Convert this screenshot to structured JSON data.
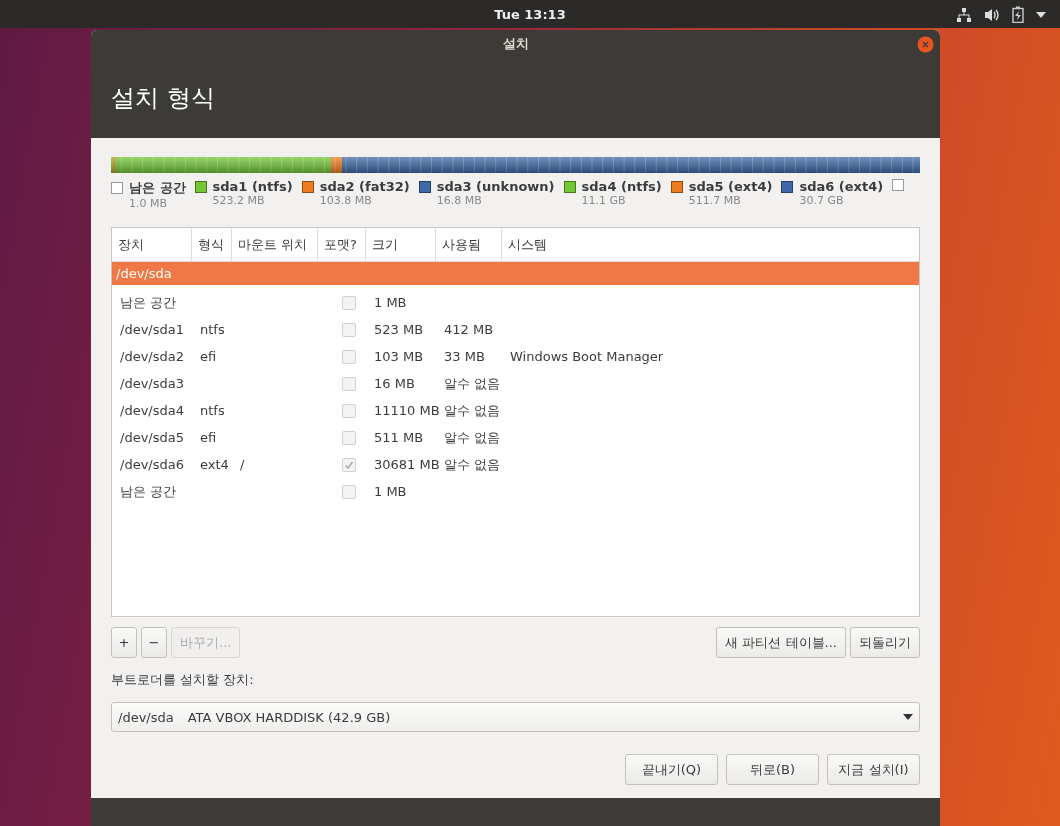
{
  "top_bar": {
    "clock": "Tue 13:13"
  },
  "window": {
    "title": "설치",
    "heading": "설치 형식"
  },
  "legend": [
    {
      "name": "남은 공간",
      "size": "1.0 MB",
      "color": "#ffffff"
    },
    {
      "name": "sda1 (ntfs)",
      "size": "523.2 MB",
      "color": "#73c737"
    },
    {
      "name": "sda2 (fat32)",
      "size": "103.8 MB",
      "color": "#ef7d1f"
    },
    {
      "name": "sda3 (unknown)",
      "size": "16.8 MB",
      "color": "#3e68a6"
    },
    {
      "name": "sda4 (ntfs)",
      "size": "11.1 GB",
      "color": "#73c737"
    },
    {
      "name": "sda5 (ext4)",
      "size": "511.7 MB",
      "color": "#ef7d1f"
    },
    {
      "name": "sda6 (ext4)",
      "size": "30.7 GB",
      "color": "#3e68a6"
    },
    {
      "color": "#ffffff"
    }
  ],
  "table": {
    "columns": [
      "장치",
      "형식",
      "마운트 위치",
      "포맷?",
      "크기",
      "사용됨",
      "시스템"
    ],
    "rows": [
      {
        "kind": "disk",
        "device": "/dev/sda",
        "selected": true
      },
      {
        "kind": "partition",
        "device": "남은 공간",
        "format": false,
        "size": "1 MB",
        "selected": false
      },
      {
        "kind": "partition",
        "device": "/dev/sda1",
        "type": "ntfs",
        "format": false,
        "size": "523 MB",
        "used": "412 MB",
        "selected": false
      },
      {
        "kind": "partition",
        "device": "/dev/sda2",
        "type": "efi",
        "format": false,
        "size": "103 MB",
        "used": "33 MB",
        "system": "Windows Boot Manager",
        "selected": false
      },
      {
        "kind": "partition",
        "device": "/dev/sda3",
        "format": false,
        "size": "16 MB",
        "used": "알수 없음",
        "selected": false
      },
      {
        "kind": "partition",
        "device": "/dev/sda4",
        "type": "ntfs",
        "format": false,
        "size": "11110 MB",
        "used": "알수 없음",
        "selected": false
      },
      {
        "kind": "partition",
        "device": "/dev/sda5",
        "type": "efi",
        "format": false,
        "size": "511 MB",
        "used": "알수 없음",
        "selected": false
      },
      {
        "kind": "partition",
        "device": "/dev/sda6",
        "type": "ext4",
        "mount": "/",
        "format": true,
        "size": "30681 MB",
        "used": "알수 없음",
        "selected": false
      },
      {
        "kind": "partition",
        "device": "남은 공간",
        "format": false,
        "size": "1 MB",
        "selected": false
      }
    ]
  },
  "table_buttons": [
    {
      "label": "+",
      "disabled": false
    },
    {
      "label": "−",
      "disabled": false
    },
    {
      "label": "바꾸기...",
      "disabled": true
    }
  ],
  "table_actions": [
    "새 파티션 테이블...",
    "되돌리기"
  ],
  "bootloader": {
    "label": "부트로더를 설치할 장치:",
    "device": "/dev/sda",
    "description": "ATA VBOX HARDDISK (42.9 GB)"
  },
  "buttons": [
    "끝내기(Q)",
    "뒤로(B)",
    "지금 설치(I)"
  ]
}
